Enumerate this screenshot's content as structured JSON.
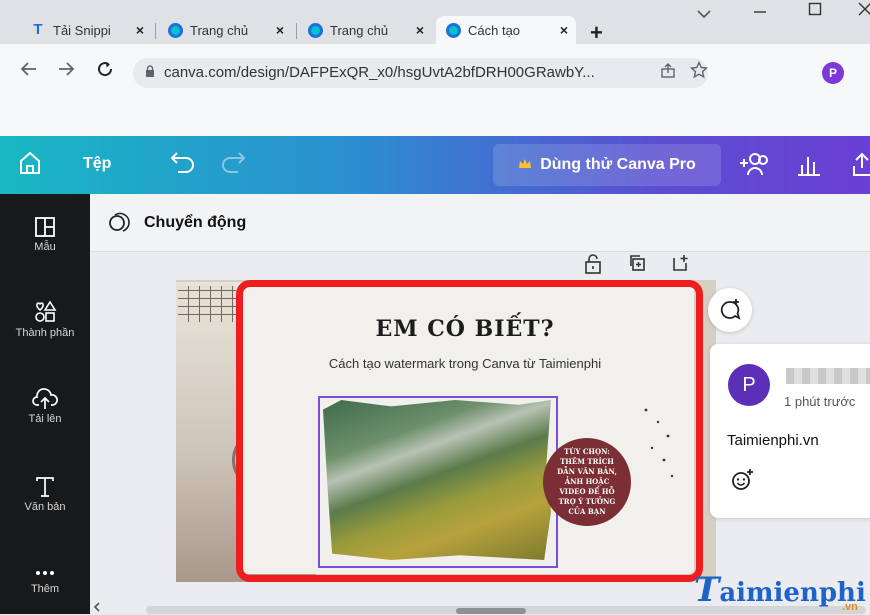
{
  "browser": {
    "tabs": [
      {
        "title": "Tải Snippi",
        "favicon": "T"
      },
      {
        "title": "Trang chủ",
        "favicon": "canva-icon"
      },
      {
        "title": "Trang chủ",
        "favicon": "canva-icon"
      },
      {
        "title": "Cách tạo",
        "favicon": "canva-icon"
      }
    ],
    "close_glyph": "×",
    "new_tab_glyph": "+",
    "url": "canva.com/design/DAFPExQR_x0/hsgUvtA2bfDRH00GRawbY...",
    "profile_initial": "P",
    "profile_color": "#7b39d8"
  },
  "canva_header": {
    "file_label": "Tệp",
    "pro_button_label": "Dùng thử Canva Pro",
    "crown_color": "#ffc22e"
  },
  "sidebar": {
    "items": [
      {
        "label": "Mẫu",
        "icon": "template-icon"
      },
      {
        "label": "Thành phần",
        "icon": "elements-icon"
      },
      {
        "label": "Tải lên",
        "icon": "upload-cloud-icon"
      },
      {
        "label": "Văn bản",
        "icon": "text-icon"
      },
      {
        "label": "Thêm",
        "icon": "more-icon"
      }
    ]
  },
  "editor": {
    "animation_label": "Chuyển động"
  },
  "design": {
    "title": "EM CÓ BIẾT?",
    "subtitle": "Cách tạo watermark trong Canva từ Taimienphi",
    "tip_text": "TÙY CHỌN: THÊM TRÍCH DẪN VĂN BẢN, ẢNH HOẶC VIDEO ĐỂ HỖ TRỢ Ý TƯỞNG CỦA BẠN",
    "tip_color": "#7b2e33",
    "highlight_color": "#ef1d1d",
    "frame_color": "#7b4ddb"
  },
  "comment": {
    "avatar_initial": "P",
    "time": "1 phút trước",
    "text": "Taimienphi.vn"
  },
  "watermark": {
    "first_letter": "T",
    "rest": "aimienphi",
    "suffix": ".vn"
  }
}
